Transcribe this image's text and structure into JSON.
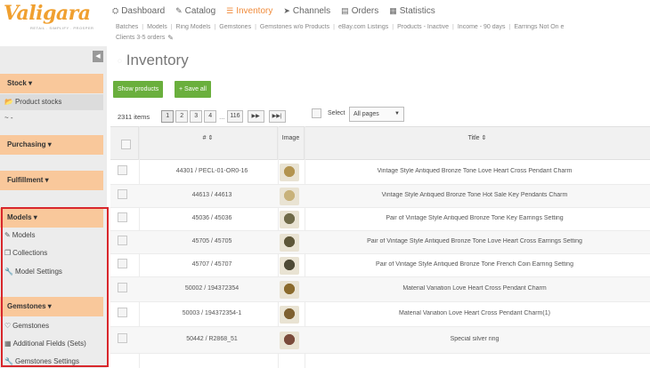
{
  "logo": {
    "text": "Valigara",
    "tagline": "RETAIL . SIMPLIFY . PROSPER"
  },
  "nav": [
    {
      "label": "Dashboard",
      "icon": "⛭",
      "active": false
    },
    {
      "label": "Catalog",
      "icon": "✎",
      "active": false
    },
    {
      "label": "Inventory",
      "icon": "☰",
      "active": true
    },
    {
      "label": "Channels",
      "icon": "➤",
      "active": false
    },
    {
      "label": "Orders",
      "icon": "▤",
      "active": false
    },
    {
      "label": "Statistics",
      "icon": "▦",
      "active": false
    }
  ],
  "subnav": [
    "Batches",
    "Models",
    "Ring Models",
    "Gemstones",
    "Gemstones w/o Products",
    "eBay.com Listings",
    "Products - Inactive",
    "Income - 90 days",
    "Earrings Not On e"
  ],
  "subnav2": {
    "label": "Clients 3-5 orders"
  },
  "sidebar": {
    "collapse": "◀",
    "sections": [
      {
        "label": "Stock ▾"
      },
      {
        "label": "Purchasing ▾"
      },
      {
        "label": "Fulfillment ▾"
      },
      {
        "label": "Models ▾"
      },
      {
        "label": "Gemstones ▾"
      }
    ],
    "items": [
      {
        "label": "Product stocks",
        "icon": "📂"
      },
      {
        "label": "~ -",
        "icon": ""
      },
      {
        "label": "Models",
        "icon": "✎"
      },
      {
        "label": "Collections",
        "icon": "❐"
      },
      {
        "label": "Model Settings",
        "icon": "🔧"
      },
      {
        "label": "Gemstones",
        "icon": "♡"
      },
      {
        "label": "Additional Fields (Sets)",
        "icon": "▦"
      },
      {
        "label": "Gemstones Settings",
        "icon": "🔧"
      }
    ]
  },
  "main": {
    "title": "Inventory",
    "buttons": {
      "show_products": "Show products",
      "save_all": "+ Save all"
    },
    "pager": {
      "count": "2311 items",
      "pages": [
        "1",
        "2",
        "3",
        "4"
      ],
      "last": "116",
      "dots": "...",
      "next": "▶▶",
      "end": "▶▶|"
    },
    "select": {
      "label": "Select",
      "value": "All pages"
    },
    "columns": {
      "id": "# ⇕",
      "image": "Image",
      "title": "Title ⇕"
    }
  },
  "rows": [
    {
      "id": "44301 / PECL-01-OR0-16",
      "title": "Vintage Style Antiqued Bronze Tone Love Heart Cross Pendant Charm",
      "thumb": "#b39450"
    },
    {
      "id": "44613 / 44613",
      "title": "Vintage Style Antiqued Bronze Tone Hot Sale Key Pendants Charm",
      "thumb": "#c8b27a"
    },
    {
      "id": "45036 / 45036",
      "title": "Pair of Vintage Style Antiqued Bronze Tone Key Earrings Setting",
      "thumb": "#6f6a48"
    },
    {
      "id": "45705 / 45705",
      "title": "Pair of Vintage Style Antiqued Bronze Tone Love Heart Cross Earrings Setting",
      "thumb": "#5d5638"
    },
    {
      "id": "45707 / 45707",
      "title": "Pair of Vintage Style Antiqued Bronze Tone French Coin Earring Setting",
      "thumb": "#4e4a36"
    },
    {
      "id": "50002 / 194372354",
      "title": "Material Variation Love Heart Cross Pendant Charm",
      "thumb": "#8a6a2c"
    },
    {
      "id": "50003 / 194372354-1",
      "title": "Material Variation Love Heart Cross Pendant Charm(1)",
      "thumb": "#7e6030"
    },
    {
      "id": "50442 / R2868_51",
      "title": "Special silver ring",
      "thumb": "#7a4a3a"
    }
  ]
}
